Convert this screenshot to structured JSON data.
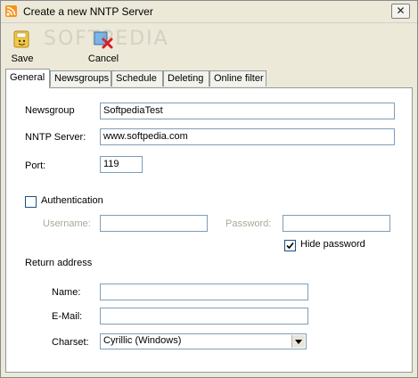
{
  "window": {
    "title": "Create a new NNTP Server",
    "close_glyph": "✕"
  },
  "toolbar": {
    "save_label": "Save",
    "cancel_label": "Cancel",
    "watermark": "SOFTPEDIA"
  },
  "tabs": [
    {
      "label": "General",
      "active": true
    },
    {
      "label": "Newsgroups",
      "active": false
    },
    {
      "label": "Schedule",
      "active": false
    },
    {
      "label": "Deleting",
      "active": false
    },
    {
      "label": "Online filter",
      "active": false
    }
  ],
  "form": {
    "newsgroup_label": "Newsgroup",
    "newsgroup_value": "SoftpediaTest",
    "server_label": "NNTP Server:",
    "server_value": "www.softpedia.com",
    "port_label": "Port:",
    "port_value": "119",
    "auth_label": "Authentication",
    "auth_checked": false,
    "username_label": "Username:",
    "username_value": "",
    "password_label": "Password:",
    "password_value": "",
    "hide_password_label": "Hide password",
    "hide_password_checked": true,
    "return_address_label": "Return address",
    "name_label": "Name:",
    "name_value": "",
    "email_label": "E-Mail:",
    "email_value": "",
    "charset_label": "Charset:",
    "charset_value": "Cyrillic (Windows)"
  }
}
